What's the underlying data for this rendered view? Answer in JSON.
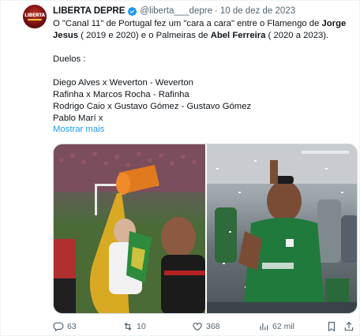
{
  "tweet": {
    "author_name": "LIBERTA DEPRE",
    "handle": "@liberta___depre",
    "separator": "·",
    "date": "10 de dez de 2023",
    "lines": [
      "O \"Canal 11\" de Portugal fez um \"cara a cara\" entre o Flamengo de",
      "Jorge",
      "Jesus",
      " ( 2019 e 2020) e o Palmeiras de ",
      "Abel Ferreira",
      " ( 2020 a 2023)."
    ],
    "duelos_title": "Duelos :",
    "duelos": [
      "Diego Alves x Weverton - Weverton",
      "Rafinha x Marcos Rocha - Rafinha",
      "Rodrigo Caio x Gustavo Gómez - Gustavo Gómez",
      "Pablo Marí x"
    ],
    "show_more": "Mostrar mais",
    "media_icons": [
      "photo-celebration-left",
      "photo-celebration-right"
    ]
  },
  "actions": {
    "replies": "63",
    "reposts": "10",
    "likes": "368",
    "views": "62 mil"
  },
  "colors": {
    "accent": "#1d9bf0",
    "text": "#0f1419",
    "muted": "#536471"
  }
}
